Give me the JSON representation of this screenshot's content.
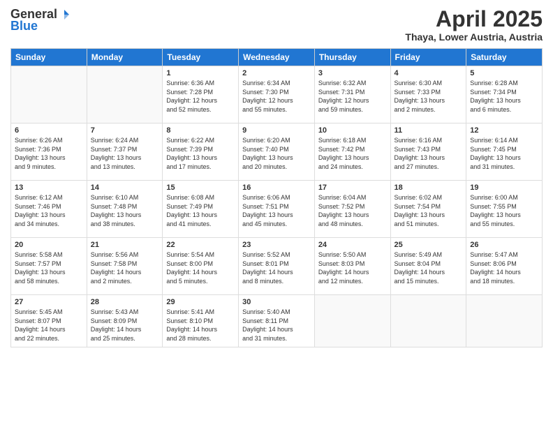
{
  "header": {
    "logo_general": "General",
    "logo_blue": "Blue",
    "month_title": "April 2025",
    "subtitle": "Thaya, Lower Austria, Austria"
  },
  "weekdays": [
    "Sunday",
    "Monday",
    "Tuesday",
    "Wednesday",
    "Thursday",
    "Friday",
    "Saturday"
  ],
  "weeks": [
    [
      {
        "num": "",
        "info": ""
      },
      {
        "num": "",
        "info": ""
      },
      {
        "num": "1",
        "info": "Sunrise: 6:36 AM\nSunset: 7:28 PM\nDaylight: 12 hours\nand 52 minutes."
      },
      {
        "num": "2",
        "info": "Sunrise: 6:34 AM\nSunset: 7:30 PM\nDaylight: 12 hours\nand 55 minutes."
      },
      {
        "num": "3",
        "info": "Sunrise: 6:32 AM\nSunset: 7:31 PM\nDaylight: 12 hours\nand 59 minutes."
      },
      {
        "num": "4",
        "info": "Sunrise: 6:30 AM\nSunset: 7:33 PM\nDaylight: 13 hours\nand 2 minutes."
      },
      {
        "num": "5",
        "info": "Sunrise: 6:28 AM\nSunset: 7:34 PM\nDaylight: 13 hours\nand 6 minutes."
      }
    ],
    [
      {
        "num": "6",
        "info": "Sunrise: 6:26 AM\nSunset: 7:36 PM\nDaylight: 13 hours\nand 9 minutes."
      },
      {
        "num": "7",
        "info": "Sunrise: 6:24 AM\nSunset: 7:37 PM\nDaylight: 13 hours\nand 13 minutes."
      },
      {
        "num": "8",
        "info": "Sunrise: 6:22 AM\nSunset: 7:39 PM\nDaylight: 13 hours\nand 17 minutes."
      },
      {
        "num": "9",
        "info": "Sunrise: 6:20 AM\nSunset: 7:40 PM\nDaylight: 13 hours\nand 20 minutes."
      },
      {
        "num": "10",
        "info": "Sunrise: 6:18 AM\nSunset: 7:42 PM\nDaylight: 13 hours\nand 24 minutes."
      },
      {
        "num": "11",
        "info": "Sunrise: 6:16 AM\nSunset: 7:43 PM\nDaylight: 13 hours\nand 27 minutes."
      },
      {
        "num": "12",
        "info": "Sunrise: 6:14 AM\nSunset: 7:45 PM\nDaylight: 13 hours\nand 31 minutes."
      }
    ],
    [
      {
        "num": "13",
        "info": "Sunrise: 6:12 AM\nSunset: 7:46 PM\nDaylight: 13 hours\nand 34 minutes."
      },
      {
        "num": "14",
        "info": "Sunrise: 6:10 AM\nSunset: 7:48 PM\nDaylight: 13 hours\nand 38 minutes."
      },
      {
        "num": "15",
        "info": "Sunrise: 6:08 AM\nSunset: 7:49 PM\nDaylight: 13 hours\nand 41 minutes."
      },
      {
        "num": "16",
        "info": "Sunrise: 6:06 AM\nSunset: 7:51 PM\nDaylight: 13 hours\nand 45 minutes."
      },
      {
        "num": "17",
        "info": "Sunrise: 6:04 AM\nSunset: 7:52 PM\nDaylight: 13 hours\nand 48 minutes."
      },
      {
        "num": "18",
        "info": "Sunrise: 6:02 AM\nSunset: 7:54 PM\nDaylight: 13 hours\nand 51 minutes."
      },
      {
        "num": "19",
        "info": "Sunrise: 6:00 AM\nSunset: 7:55 PM\nDaylight: 13 hours\nand 55 minutes."
      }
    ],
    [
      {
        "num": "20",
        "info": "Sunrise: 5:58 AM\nSunset: 7:57 PM\nDaylight: 13 hours\nand 58 minutes."
      },
      {
        "num": "21",
        "info": "Sunrise: 5:56 AM\nSunset: 7:58 PM\nDaylight: 14 hours\nand 2 minutes."
      },
      {
        "num": "22",
        "info": "Sunrise: 5:54 AM\nSunset: 8:00 PM\nDaylight: 14 hours\nand 5 minutes."
      },
      {
        "num": "23",
        "info": "Sunrise: 5:52 AM\nSunset: 8:01 PM\nDaylight: 14 hours\nand 8 minutes."
      },
      {
        "num": "24",
        "info": "Sunrise: 5:50 AM\nSunset: 8:03 PM\nDaylight: 14 hours\nand 12 minutes."
      },
      {
        "num": "25",
        "info": "Sunrise: 5:49 AM\nSunset: 8:04 PM\nDaylight: 14 hours\nand 15 minutes."
      },
      {
        "num": "26",
        "info": "Sunrise: 5:47 AM\nSunset: 8:06 PM\nDaylight: 14 hours\nand 18 minutes."
      }
    ],
    [
      {
        "num": "27",
        "info": "Sunrise: 5:45 AM\nSunset: 8:07 PM\nDaylight: 14 hours\nand 22 minutes."
      },
      {
        "num": "28",
        "info": "Sunrise: 5:43 AM\nSunset: 8:09 PM\nDaylight: 14 hours\nand 25 minutes."
      },
      {
        "num": "29",
        "info": "Sunrise: 5:41 AM\nSunset: 8:10 PM\nDaylight: 14 hours\nand 28 minutes."
      },
      {
        "num": "30",
        "info": "Sunrise: 5:40 AM\nSunset: 8:11 PM\nDaylight: 14 hours\nand 31 minutes."
      },
      {
        "num": "",
        "info": ""
      },
      {
        "num": "",
        "info": ""
      },
      {
        "num": "",
        "info": ""
      }
    ]
  ]
}
